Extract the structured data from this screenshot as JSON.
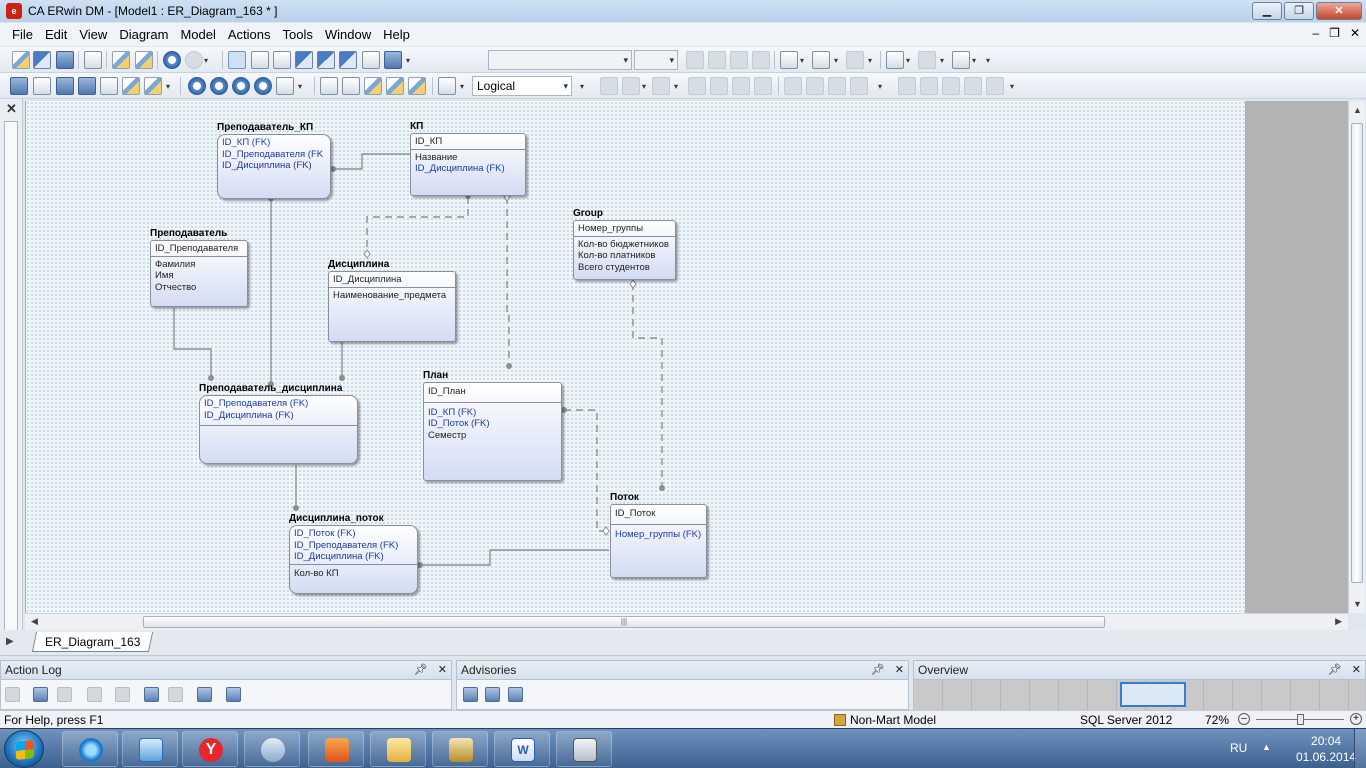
{
  "window": {
    "title": "CA ERwin DM - [Model1 : ER_Diagram_163 * ]",
    "app_icon": "erwin-app-icon"
  },
  "menu": [
    "File",
    "Edit",
    "View",
    "Diagram",
    "Model",
    "Actions",
    "Tools",
    "Window",
    "Help"
  ],
  "toolbar2": {
    "display_level": "Logical"
  },
  "entities": [
    {
      "id": "prep_kp",
      "name": "Преподаватель_КП",
      "keys": [
        "ID_КП (FK)",
        "ID_Преподавателя (FK",
        "ID_Дисциплина (FK)"
      ],
      "keys_fk": true,
      "attrs": []
    },
    {
      "id": "kp",
      "name": "КП",
      "keys": [
        "ID_КП"
      ],
      "keys_fk": false,
      "attrs": [
        "Название",
        "ID_Дисциплина (FK)"
      ],
      "attrs_fk": [
        false,
        true
      ]
    },
    {
      "id": "prep",
      "name": "Преподаватель",
      "keys": [
        "ID_Преподавателя"
      ],
      "keys_fk": false,
      "attrs": [
        "Фамилия",
        "Имя",
        "Отчество"
      ],
      "attrs_fk": [
        false,
        false,
        false
      ]
    },
    {
      "id": "disc",
      "name": "Дисциплина",
      "keys": [
        "ID_Дисциплина"
      ],
      "keys_fk": false,
      "attrs": [
        "Наименование_предмета"
      ],
      "attrs_fk": [
        false
      ]
    },
    {
      "id": "group",
      "name": "Group",
      "keys": [
        "Номер_группы"
      ],
      "keys_fk": false,
      "attrs": [
        "Кол-во бюджетников",
        "Кол-во платников",
        "Всего студентов"
      ],
      "attrs_fk": [
        false,
        false,
        false
      ]
    },
    {
      "id": "prep_disc",
      "name": "Преподаватель_дисциплина",
      "keys": [
        "ID_Преподавателя (FK)",
        "ID_Дисциплина (FK)"
      ],
      "keys_fk": true,
      "attrs": []
    },
    {
      "id": "plan",
      "name": "План",
      "keys": [
        "ID_План"
      ],
      "keys_fk": false,
      "attrs": [
        "ID_КП (FK)",
        "ID_Поток (FK)",
        "Семестр"
      ],
      "attrs_fk": [
        true,
        true,
        false
      ]
    },
    {
      "id": "potok",
      "name": "Поток",
      "keys": [
        "ID_Поток"
      ],
      "keys_fk": false,
      "attrs": [
        "Номер_группы (FK)"
      ],
      "attrs_fk": [
        true
      ]
    },
    {
      "id": "disc_potok",
      "name": "Дисциплина_поток",
      "keys": [
        "ID_Поток (FK)",
        "ID_Преподавателя (FK)",
        "ID_Дисциплина (FK)"
      ],
      "keys_fk": true,
      "attrs": [
        "Кол-во КП"
      ],
      "attrs_fk": [
        false
      ]
    }
  ],
  "tabs": {
    "diagram_tab": "ER_Diagram_163"
  },
  "panes": {
    "action_log": "Action Log",
    "advisories": "Advisories",
    "overview": "Overview"
  },
  "status": {
    "help": "For Help, press F1",
    "model_type": "Non-Mart Model",
    "target_db": "SQL Server 2012",
    "zoom": "72%",
    "zoom_fraction": 0.5
  },
  "taskbar": {
    "lang": "RU",
    "time": "20:04",
    "date": "01.06.2014",
    "apps": [
      "internet-explorer-icon",
      "mail-icon",
      "yandex-browser-icon",
      "speaker-app-icon",
      "vlc-icon",
      "explorer-folder-icon",
      "erwin-taskbar-icon",
      "word-icon",
      "network-app-icon"
    ]
  }
}
